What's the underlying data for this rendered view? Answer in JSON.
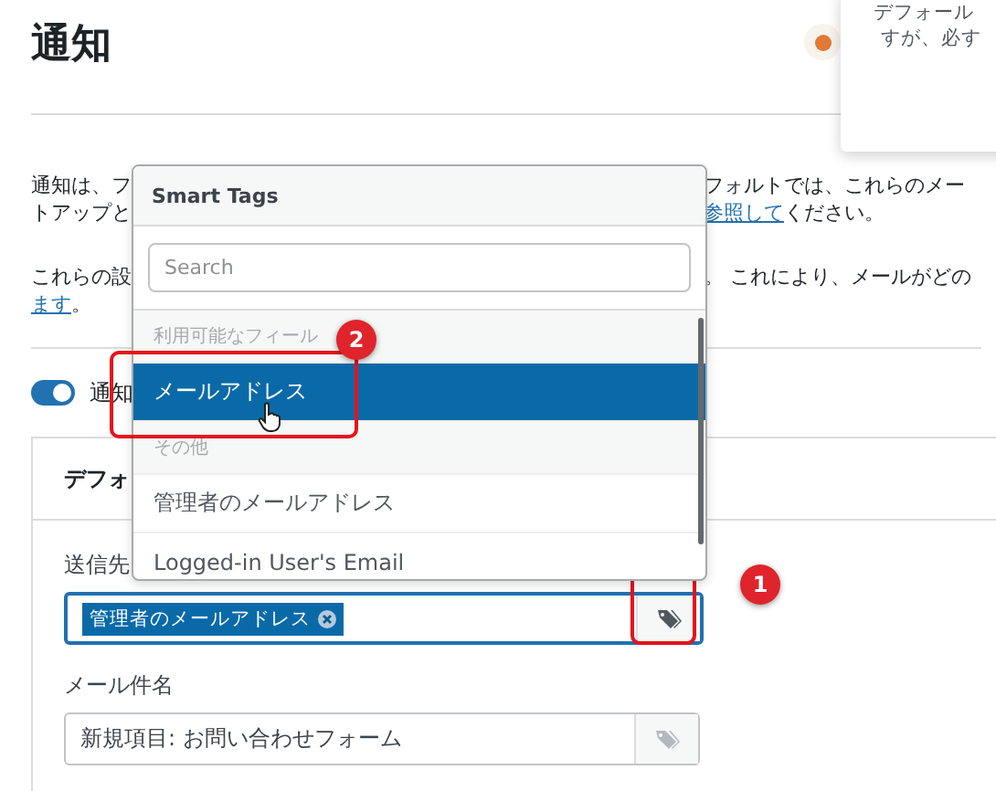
{
  "header": {
    "title": "通知",
    "tooltip_lines": [
      "デフォール",
      "すが、必す"
    ]
  },
  "paragraphs": [
    {
      "lines": [
        {
          "left": [
            {
              "text": "通知は、フ",
              "link": false
            }
          ],
          "right": [
            {
              "text": "フォルトでは、これらのメー",
              "link": false
            }
          ]
        },
        {
          "left": [
            {
              "text": "トアップと",
              "link": false
            }
          ],
          "right": [
            {
              "text": "参照して",
              "link": true
            },
            {
              "text": "ください。",
              "link": false
            }
          ]
        }
      ]
    },
    {
      "lines": [
        {
          "left": [
            {
              "text": "これらの設",
              "link": false
            }
          ],
          "right": [
            {
              "text": "。 これにより、メールがどの",
              "link": false
            }
          ]
        },
        {
          "left": [
            {
              "text": "ます",
              "link": true
            },
            {
              "text": "。",
              "link": false
            }
          ]
        }
      ]
    }
  ],
  "toggle": {
    "on": true,
    "label": "通知"
  },
  "card": {
    "title": "デフォ",
    "fields": [
      {
        "kind": "tags",
        "label": "送信先",
        "tags": [
          "管理者のメールアドレス"
        ],
        "focused": true,
        "callout": "1"
      },
      {
        "kind": "text",
        "label": "メール件名",
        "value": "新規項目: お問い合わせフォーム",
        "focused": false
      }
    ]
  },
  "dropdown": {
    "title": "Smart Tags",
    "search_placeholder": "Search",
    "groups": [
      {
        "label": "利用可能なフィール",
        "items": [
          {
            "label": "メールアドレス",
            "selected": true,
            "callout": "2"
          }
        ]
      },
      {
        "label": "その他",
        "items": [
          {
            "label": "管理者のメールアドレス",
            "selected": false
          },
          {
            "label": "Logged-in User's Email",
            "selected": false
          }
        ]
      }
    ]
  }
}
